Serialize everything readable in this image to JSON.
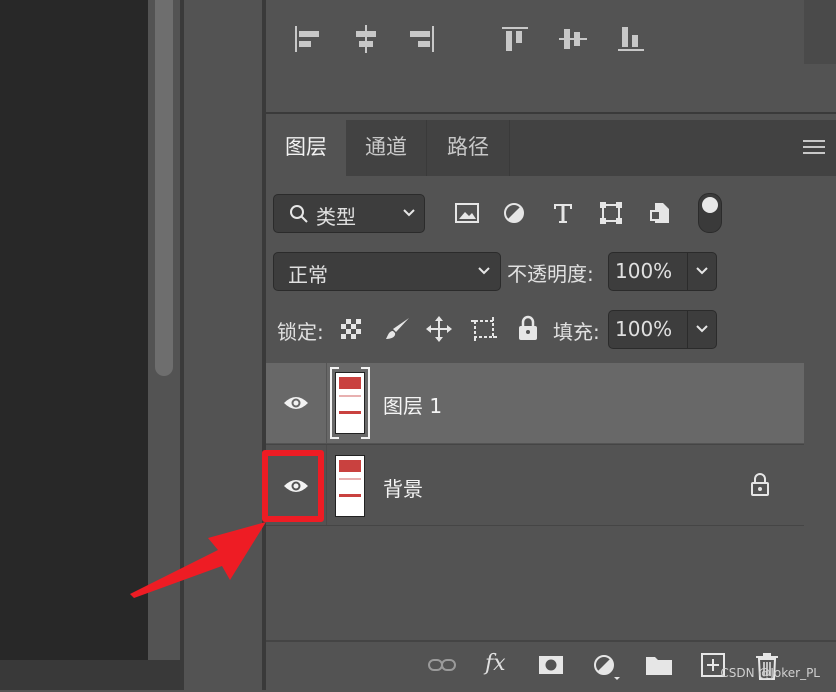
{
  "layers_panel": {
    "tabs": [
      {
        "label": "图层",
        "active": true
      },
      {
        "label": "通道",
        "active": false
      },
      {
        "label": "路径",
        "active": false
      }
    ],
    "filter": {
      "label": "类型"
    },
    "blend_mode": {
      "value": "正常"
    },
    "opacity": {
      "label": "不透明度:",
      "value": "100%"
    },
    "lock": {
      "label": "锁定:"
    },
    "fill": {
      "label": "填充:",
      "value": "100%"
    },
    "layers": [
      {
        "name": "图层 1",
        "selected": true,
        "visible": true,
        "locked": false
      },
      {
        "name": "背景",
        "selected": false,
        "visible": true,
        "locked": true
      }
    ],
    "footer_fx": "fx"
  },
  "annotation": {
    "color": "#ee1c24"
  },
  "watermark": "CSDN @Joker_PL",
  "colors": {
    "panel": "#535353",
    "selected_row": "#686868",
    "tab_bar": "#424242",
    "dark": "#282828"
  }
}
